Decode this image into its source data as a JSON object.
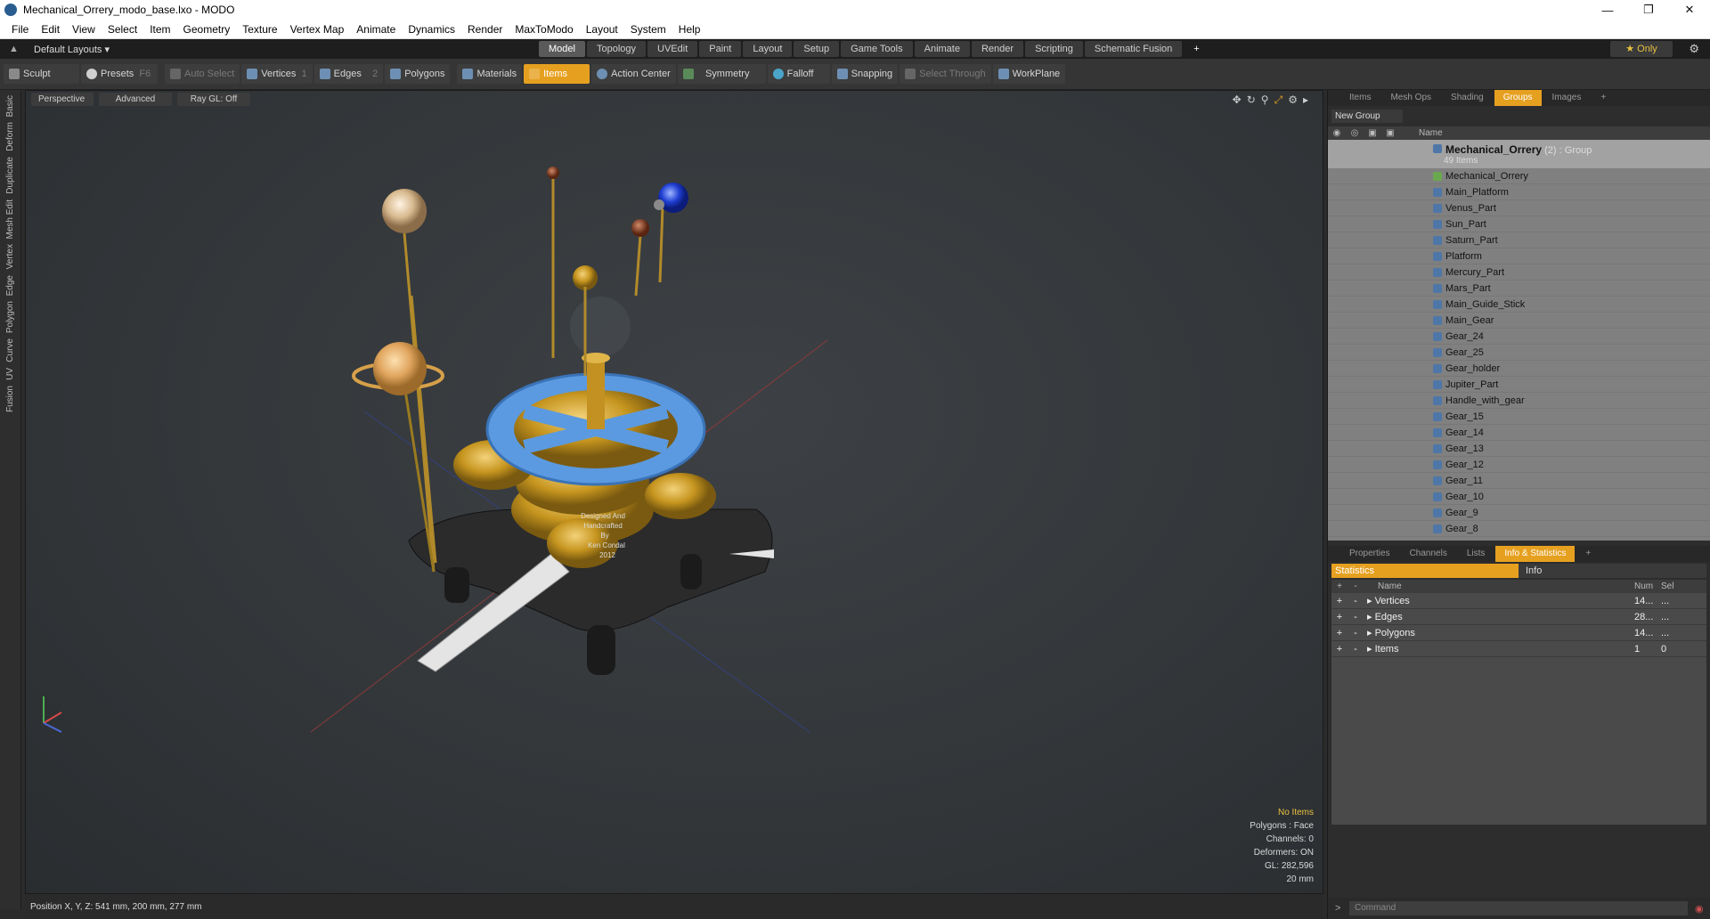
{
  "window": {
    "title": "Mechanical_Orrery_modo_base.lxo - MODO"
  },
  "menu": [
    "File",
    "Edit",
    "View",
    "Select",
    "Item",
    "Geometry",
    "Texture",
    "Vertex Map",
    "Animate",
    "Dynamics",
    "Render",
    "MaxToModo",
    "Layout",
    "System",
    "Help"
  ],
  "layout_bar": {
    "selector": "Default Layouts",
    "tabs": [
      "Model",
      "Topology",
      "UVEdit",
      "Paint",
      "Layout",
      "Setup",
      "Game Tools",
      "Animate",
      "Render",
      "Scripting",
      "Schematic Fusion"
    ],
    "active_tab": "Model",
    "only_label": "Only"
  },
  "toolbar": {
    "sculpt": "Sculpt",
    "presets": "Presets",
    "presets_key": "F6",
    "auto_select": "Auto Select",
    "vertices": "Vertices",
    "vertices_n": "1",
    "edges": "Edges",
    "edges_n": "2",
    "polygons": "Polygons",
    "materials": "Materials",
    "items": "Items",
    "action_center": "Action Center",
    "symmetry": "Symmetry",
    "falloff": "Falloff",
    "snapping": "Snapping",
    "select_through": "Select Through",
    "workplane": "WorkPlane"
  },
  "side_tabs": [
    "Basic",
    "Deform",
    "Duplicate",
    "Mesh Edit",
    "Vertex",
    "Edge",
    "Polygon",
    "Curve",
    "UV",
    "Fusion"
  ],
  "viewport": {
    "perspective": "Perspective",
    "advanced": "Advanced",
    "raygl": "Ray GL: Off",
    "overlay": {
      "no_items": "No Items",
      "polygons": "Polygons : Face",
      "channels": "Channels: 0",
      "deformers": "Deformers: ON",
      "gl": "GL: 282,596",
      "scale": "20 mm"
    },
    "plate_text": [
      "Designed And",
      "Handcrafted",
      "By",
      "Ken Condal",
      "2012"
    ]
  },
  "status": {
    "position": "Position X, Y, Z:   541 mm, 200 mm, 277 mm"
  },
  "groups_panel": {
    "tabs": [
      "Items",
      "Mesh Ops",
      "Shading",
      "Groups",
      "Images"
    ],
    "active_tab": "Groups",
    "new_group": "New Group",
    "col_name": "Name",
    "group_name": "Mechanical_Orrery",
    "group_suffix": "(2) : Group",
    "group_count": "49 Items",
    "items": [
      "Mechanical_Orrery",
      "Main_Platform",
      "Venus_Part",
      "Sun_Part",
      "Saturn_Part",
      "Platform",
      "Mercury_Part",
      "Mars_Part",
      "Main_Guide_Stick",
      "Main_Gear",
      "Gear_24",
      "Gear_25",
      "Gear_holder",
      "Jupiter_Part",
      "Handle_with_gear",
      "Gear_15",
      "Gear_14",
      "Gear_13",
      "Gear_12",
      "Gear_11",
      "Gear_10",
      "Gear_9",
      "Gear_8"
    ]
  },
  "info_panel": {
    "tabs": [
      "Properties",
      "Channels",
      "Lists",
      "Info & Statistics"
    ],
    "active_tab": "Info & Statistics",
    "statistics": "Statistics",
    "info": "Info",
    "col_name": "Name",
    "col_num": "Num",
    "col_sel": "Sel",
    "rows": [
      {
        "name": "Vertices",
        "num": "14...",
        "sel": "..."
      },
      {
        "name": "Edges",
        "num": "28...",
        "sel": "..."
      },
      {
        "name": "Polygons",
        "num": "14...",
        "sel": "..."
      },
      {
        "name": "Items",
        "num": "1",
        "sel": "0"
      }
    ]
  },
  "command": {
    "placeholder": "Command"
  }
}
